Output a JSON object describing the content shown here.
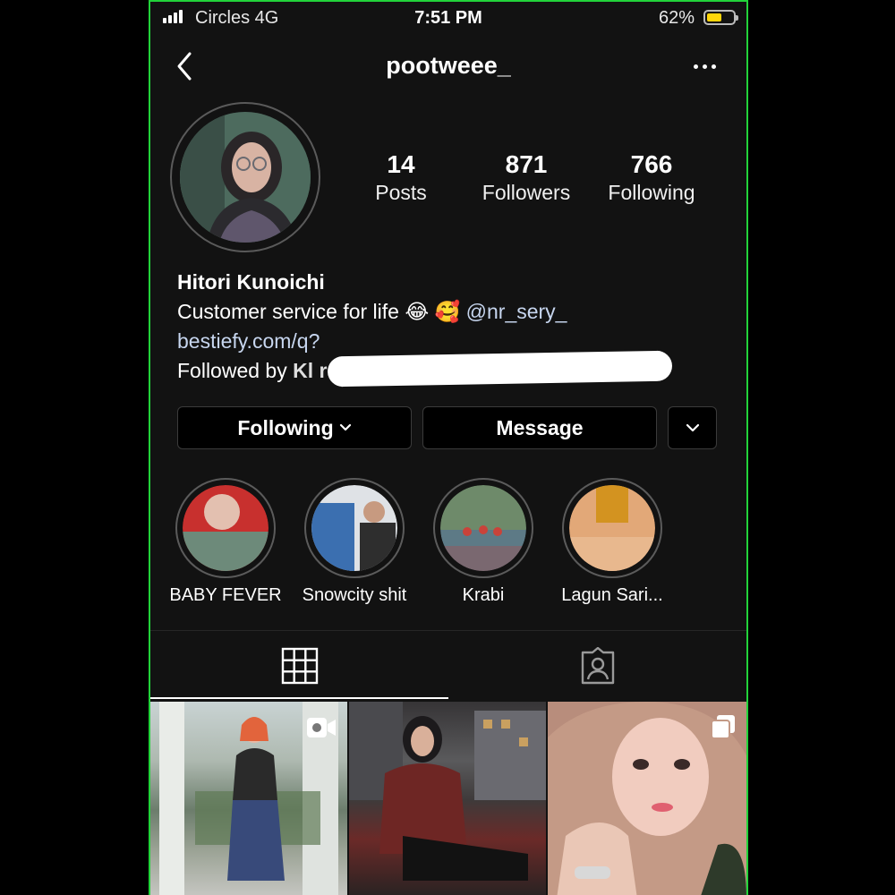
{
  "status_bar": {
    "carrier": "Circles   4G",
    "time": "7:51 PM",
    "battery_pct": "62%",
    "battery_level": 0.62,
    "battery_color": "#ffd60a"
  },
  "header": {
    "username": "pootweee_",
    "back_icon": "chevron-left-icon",
    "more_icon": "ellipsis-icon"
  },
  "stats": [
    {
      "count": "14",
      "label": "Posts"
    },
    {
      "count": "871",
      "label": "Followers"
    },
    {
      "count": "766",
      "label": "Following"
    }
  ],
  "bio": {
    "name": "Hitori Kunoichi",
    "line_text": "Customer service for life 😂 🥰",
    "mention": "@nr_sery_",
    "link": "bestiefy.com/q?",
    "followed_by_prefix": "Followed by",
    "followed_by_names": "Kl                                                  rs"
  },
  "buttons": {
    "following": "Following",
    "message": "Message"
  },
  "highlights": [
    {
      "label": "BABY FEVER"
    },
    {
      "label": "Snowcity shit"
    },
    {
      "label": "Krabi"
    },
    {
      "label": "Lagun Sari..."
    }
  ],
  "tabs": {
    "grid_icon": "grid-icon",
    "tagged_icon": "tagged-person-icon"
  },
  "colors": {
    "background": "#121212",
    "link": "#c7d6ef",
    "frame": "#22d33a"
  }
}
